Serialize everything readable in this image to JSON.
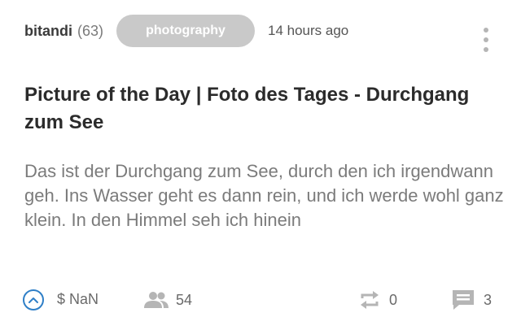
{
  "post": {
    "author": "bitandi",
    "reputation": "(63)",
    "tag": "photography",
    "time": "14 hours ago",
    "title": "Picture of the Day | Foto des Tages - Durchgang zum See",
    "excerpt": "Das ist der Durchgang zum See, durch den ich irgendwann geh. Ins Wasser geht es dann rein, und ich werde wohl ganz klein. In den Himmel seh ich hinein"
  },
  "footer": {
    "payout": "$ NaN",
    "voters": "54",
    "reblogs": "0",
    "comments": "3"
  },
  "icons": {
    "upvote": "chevron-up-circle-icon",
    "voters": "people-icon",
    "reblog": "repeat-icon",
    "comments": "comment-icon",
    "menu": "more-vertical-icon"
  },
  "colors": {
    "accent": "#2f7fc7",
    "tag_background": "#c9c9c9",
    "icon_gray": "#b5b5b5"
  }
}
